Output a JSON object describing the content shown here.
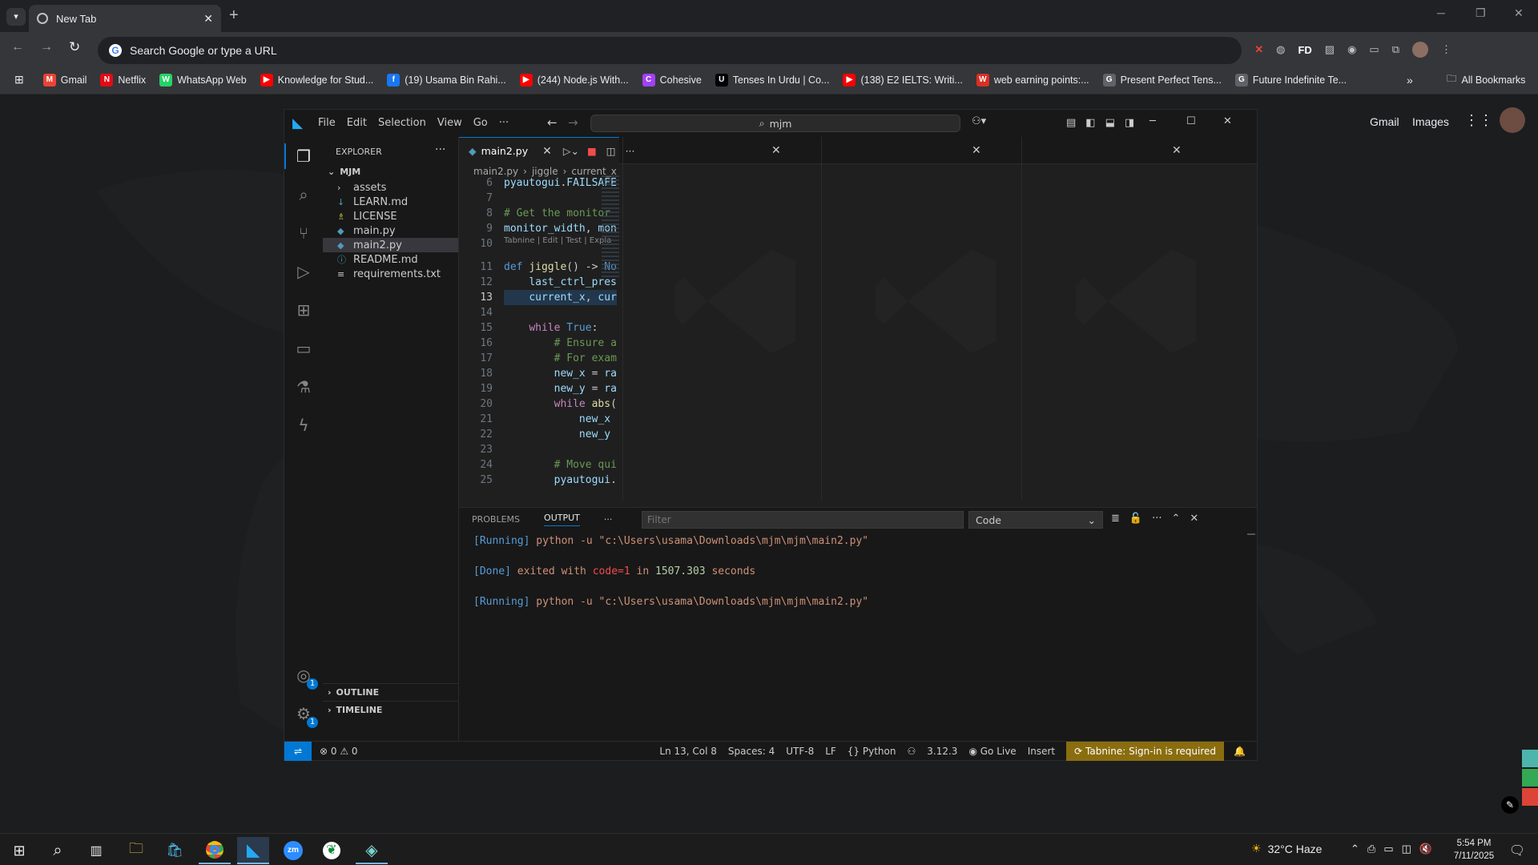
{
  "browser": {
    "tab_title": "New Tab",
    "omnibox_placeholder": "Search Google or type a URL",
    "bookmarks": [
      {
        "label": "Gmail",
        "color": "#ea4335",
        "glyph": "M"
      },
      {
        "label": "Netflix",
        "color": "#e50914",
        "glyph": "N"
      },
      {
        "label": "WhatsApp Web",
        "color": "#25d366",
        "glyph": "W"
      },
      {
        "label": "Knowledge for Stud...",
        "color": "#ff0000",
        "glyph": "▶"
      },
      {
        "label": "(19) Usama Bin Rahi...",
        "color": "#1877f2",
        "glyph": "f"
      },
      {
        "label": "(244) Node.js With...",
        "color": "#ff0000",
        "glyph": "▶"
      },
      {
        "label": "Cohesive",
        "color": "#a142f4",
        "glyph": "C"
      },
      {
        "label": "Tenses In Urdu | Co...",
        "color": "#000000",
        "glyph": "U"
      },
      {
        "label": "(138) E2 IELTS: Writi...",
        "color": "#ff0000",
        "glyph": "▶"
      },
      {
        "label": "web earning points:...",
        "color": "#d93025",
        "glyph": "W"
      },
      {
        "label": "Present Perfect Tens...",
        "color": "#5f6368",
        "glyph": "G"
      },
      {
        "label": "Future Indefinite Te...",
        "color": "#5f6368",
        "glyph": "G"
      }
    ],
    "all_bookmarks": "All Bookmarks",
    "gmail_link": "Gmail",
    "images_link": "Images"
  },
  "vscode": {
    "menu": [
      "File",
      "Edit",
      "Selection",
      "View",
      "Go",
      "···"
    ],
    "search_text": "mjm",
    "explorer_title": "EXPLORER",
    "folder_name": "MJM",
    "files": [
      {
        "name": "assets",
        "icon": "›",
        "color": "#cccccc"
      },
      {
        "name": "LEARN.md",
        "icon": "↓",
        "color": "#519aba"
      },
      {
        "name": "LICENSE",
        "icon": "♗",
        "color": "#cbcb41"
      },
      {
        "name": "main.py",
        "icon": "◆",
        "color": "#519aba"
      },
      {
        "name": "main2.py",
        "icon": "◆",
        "color": "#519aba"
      },
      {
        "name": "README.md",
        "icon": "ⓘ",
        "color": "#519aba"
      },
      {
        "name": "requirements.txt",
        "icon": "≡",
        "color": "#cccccc"
      }
    ],
    "outline": "OUTLINE",
    "timeline": "TIMELINE",
    "editor_tab": "main2.py",
    "breadcrumb": [
      "main2.py",
      "jiggle",
      "current_x"
    ],
    "tabnine_hint": "Tabnine | Edit | Test | Expla",
    "code": [
      {
        "n": "6",
        "html": "<span class='var'>pyautogui</span>.<span class='var'>FAILSAFE</span>"
      },
      {
        "n": "7",
        "html": ""
      },
      {
        "n": "8",
        "html": "<span class='cm'># Get the monitor</span>"
      },
      {
        "n": "9",
        "html": "<span class='var'>monitor_width</span>, <span class='var'>mon</span>"
      },
      {
        "n": "10",
        "html": ""
      },
      {
        "n": "11",
        "html": "<span class='kw'>def</span> <span class='fn'>jiggle</span>() -&gt; <span class='kw'>No</span>"
      },
      {
        "n": "12",
        "html": "    <span class='var'>last_ctrl_pres</span>"
      },
      {
        "n": "13",
        "html": "    <span class='var'>current_x</span>, <span class='var'>cur</span>"
      },
      {
        "n": "14",
        "html": ""
      },
      {
        "n": "15",
        "html": "    <span class='ctl'>while</span> <span class='kw'>True</span>:"
      },
      {
        "n": "16",
        "html": "        <span class='cm'># Ensure a</span>"
      },
      {
        "n": "17",
        "html": "        <span class='cm'># For exam</span>"
      },
      {
        "n": "18",
        "html": "        <span class='var'>new_x</span> = <span class='var'>ra</span>"
      },
      {
        "n": "19",
        "html": "        <span class='var'>new_y</span> = <span class='var'>ra</span>"
      },
      {
        "n": "20",
        "html": "        <span class='ctl'>while</span> <span class='fn'>abs</span>("
      },
      {
        "n": "21",
        "html": "            <span class='var'>new_x</span>"
      },
      {
        "n": "22",
        "html": "            <span class='var'>new_y</span>"
      },
      {
        "n": "23",
        "html": ""
      },
      {
        "n": "24",
        "html": "        <span class='cm'># Move qui</span>"
      },
      {
        "n": "25",
        "html": "        <span class='var'>pyautogui</span>."
      }
    ],
    "panel_tabs": [
      "PROBLEMS",
      "OUTPUT",
      "···"
    ],
    "filter_placeholder": "Filter",
    "output_channel": "Code",
    "output_lines": [
      {
        "tag": "[Running]",
        "rest": " python -u \"c:\\Users\\usama\\Downloads\\mjm\\mjm\\main2.py\""
      },
      {
        "tag": "[Done]",
        "rest": " exited with ",
        "code": "code=1",
        "in": " in ",
        "time": "1507.303",
        "tail": " seconds"
      },
      {
        "tag": "[Running]",
        "rest": " python -u \"c:\\Users\\usama\\Downloads\\mjm\\mjm\\main2.py\""
      }
    ],
    "status": {
      "errors": "0",
      "warnings": "0",
      "position": "Ln 13, Col 8",
      "spaces": "Spaces: 4",
      "encoding": "UTF-8",
      "eol": "LF",
      "language": "Python",
      "version": "3.12.3",
      "golive": "Go Live",
      "insert": "Insert",
      "tabnine": "Tabnine: Sign-in is required"
    },
    "badge_accounts": "1",
    "badge_settings": "1"
  },
  "taskbar": {
    "weather": "32°C  Haze",
    "time": "5:54 PM",
    "date": "7/11/2025"
  }
}
